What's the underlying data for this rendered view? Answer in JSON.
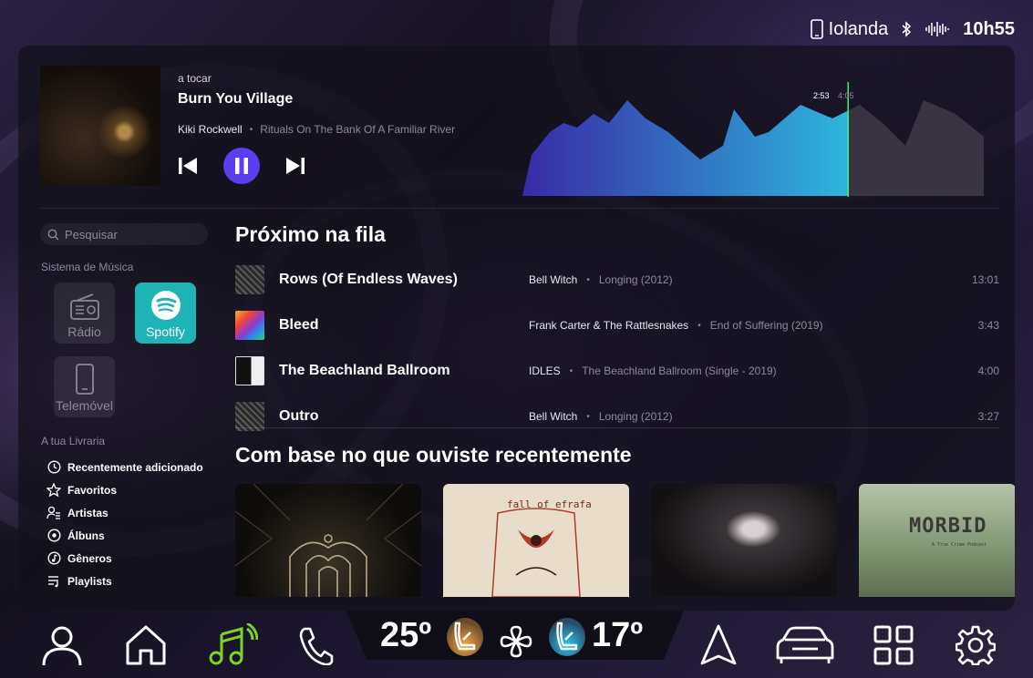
{
  "status": {
    "user": "Iolanda",
    "time": "10h55"
  },
  "now_playing": {
    "label": "a tocar",
    "title": "Burn You Village",
    "artist": "Kiki Rockwell",
    "album": "Rituals On The Bank Of A Familiar River",
    "time_current": "2:53",
    "time_total": "4:05",
    "progress": 0.706
  },
  "sidebar": {
    "search_placeholder": "Pesquisar",
    "music_system_label": "Sistema de Música",
    "sources": [
      {
        "label": "Rádio",
        "active": false
      },
      {
        "label": "Spotify",
        "active": true
      },
      {
        "label": "Telemóvel",
        "active": false
      }
    ],
    "library_label": "A tua Livraria",
    "library": [
      {
        "label": "Recentemente adicionado",
        "icon": "clock-icon"
      },
      {
        "label": "Favoritos",
        "icon": "star-icon"
      },
      {
        "label": "Artistas",
        "icon": "artist-icon"
      },
      {
        "label": "Álbuns",
        "icon": "album-icon"
      },
      {
        "label": "Gêneros",
        "icon": "genre-icon"
      },
      {
        "label": "Playlists",
        "icon": "playlist-icon"
      }
    ]
  },
  "queue": {
    "heading": "Próximo na fila",
    "items": [
      {
        "title": "Rows (Of Endless Waves)",
        "artist": "Bell Witch",
        "album": "Longing (2012)",
        "duration": "13:01"
      },
      {
        "title": "Bleed",
        "artist": "Frank Carter & The Rattlesnakes",
        "album": "End of Suffering (2019)",
        "duration": "3:43"
      },
      {
        "title": "The Beachland Ballroom",
        "artist": "IDLES",
        "album": "The Beachland Ballroom (Single - 2019)",
        "duration": "4:00"
      },
      {
        "title": "Outro",
        "artist": "Bell Witch",
        "album": "Longing (2012)",
        "duration": "3:27"
      }
    ]
  },
  "recommendations": {
    "heading": "Com base no que ouviste recentemente",
    "cards": [
      {
        "text": ""
      },
      {
        "text": "fall of efrafa"
      },
      {
        "text": ""
      },
      {
        "text": "MORBID",
        "subtext": "A True Crime Podcast"
      }
    ]
  },
  "climate": {
    "temp_left": "25º",
    "temp_right": "17º"
  },
  "colors": {
    "accent_purple": "#5a3ef0",
    "spotify_tile": "#1fb3b5",
    "music_active": "#7ed321",
    "wave_start": "#3a2aa8",
    "wave_end": "#28f0f0"
  }
}
